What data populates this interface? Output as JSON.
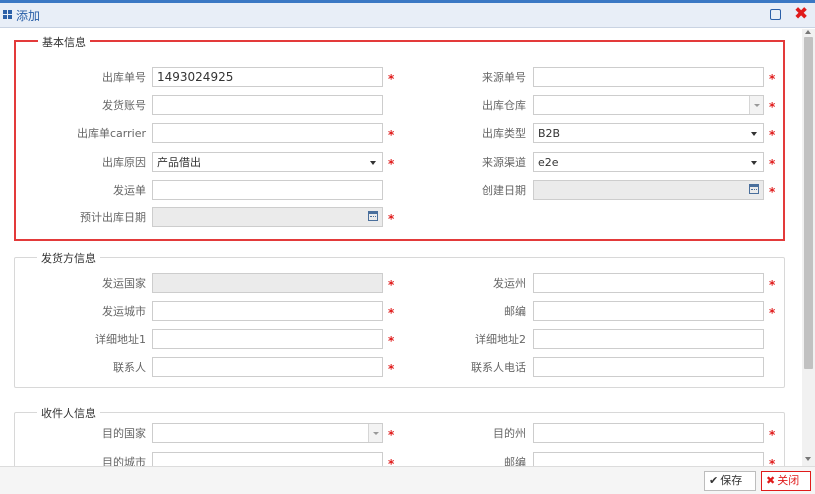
{
  "window": {
    "title": "添加",
    "maximize_icon": "square-icon",
    "close_icon": "close-x-icon"
  },
  "sections": {
    "basic": {
      "legend": "基本信息",
      "fields": {
        "outbound_no": {
          "label": "出库单号",
          "value": "1493024925"
        },
        "source_no": {
          "label": "来源单号",
          "value": ""
        },
        "ship_account": {
          "label": "发货账号",
          "value": ""
        },
        "outbound_warehouse": {
          "label": "出库仓库",
          "value": ""
        },
        "outbound_carrier": {
          "label": "出库单carrier",
          "value": ""
        },
        "outbound_type": {
          "label": "出库类型",
          "value": "B2B"
        },
        "outbound_reason": {
          "label": "出库原因",
          "value": "产品借出"
        },
        "source_channel": {
          "label": "来源渠道",
          "value": "e2e"
        },
        "shipping_order": {
          "label": "发运单",
          "value": ""
        },
        "create_date": {
          "label": "创建日期",
          "value": ""
        },
        "planned_outbound_date": {
          "label": "预计出库日期",
          "value": ""
        }
      }
    },
    "shipper": {
      "legend": "发货方信息",
      "fields": {
        "ship_country": {
          "label": "发运国家",
          "value": ""
        },
        "ship_state": {
          "label": "发运州",
          "value": ""
        },
        "ship_city": {
          "label": "发运城市",
          "value": ""
        },
        "postcode": {
          "label": "邮编",
          "value": ""
        },
        "address1": {
          "label": "详细地址1",
          "value": ""
        },
        "address2": {
          "label": "详细地址2",
          "value": ""
        },
        "contact": {
          "label": "联系人",
          "value": ""
        },
        "contact_phone": {
          "label": "联系人电话",
          "value": ""
        }
      }
    },
    "receiver": {
      "legend": "收件人信息",
      "fields": {
        "dest_country": {
          "label": "目的国家",
          "value": ""
        },
        "dest_state": {
          "label": "目的州",
          "value": ""
        },
        "dest_city": {
          "label": "目的城市",
          "value": ""
        },
        "postcode": {
          "label": "邮编",
          "value": ""
        }
      }
    }
  },
  "required_mark": "*",
  "footer": {
    "save_label": "保存",
    "close_label": "关闭"
  },
  "colors": {
    "accent": "#2a5fa8",
    "required": "#e01b1b",
    "highlight_border": "#e33a3a"
  }
}
